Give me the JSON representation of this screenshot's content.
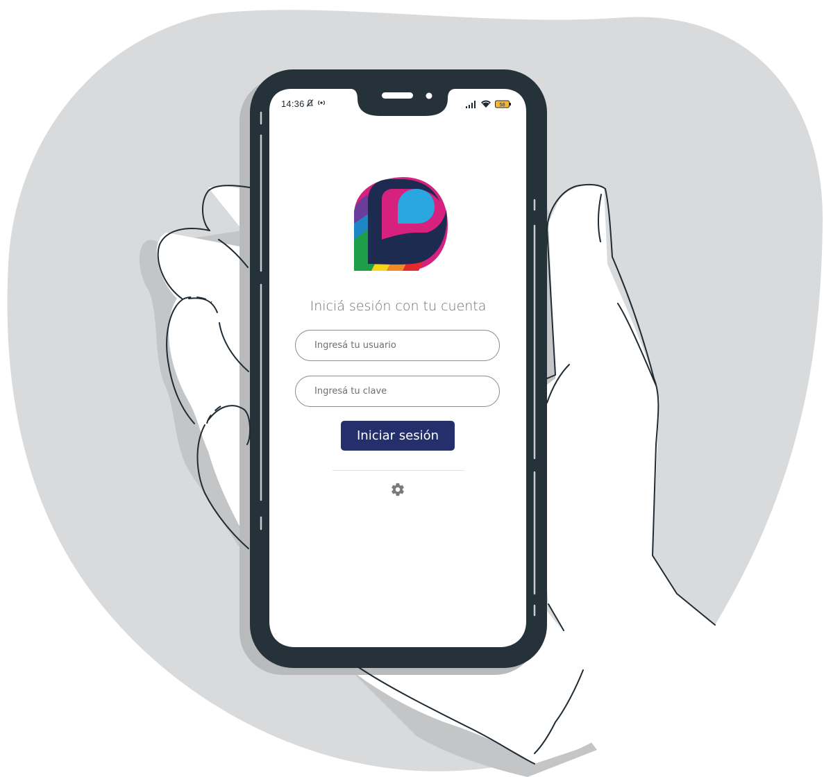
{
  "status_bar": {
    "time": "14:36",
    "battery": "58",
    "icons": [
      "bell-off-icon",
      "hotspot-icon",
      "signal-icon",
      "wifi-icon",
      "battery-icon"
    ]
  },
  "login": {
    "heading": "Iniciá sesión con tu cuenta",
    "username_placeholder": "Ingresá tu usuario",
    "password_placeholder": "Ingresá tu clave",
    "submit_label": "Iniciar sesión"
  },
  "colors": {
    "background_blob": "#d9dadb",
    "phone_body": "#26323a",
    "button": "#252f6b",
    "logo_navy": "#1c2b4f",
    "logo_blue": "#2aa7e0"
  }
}
